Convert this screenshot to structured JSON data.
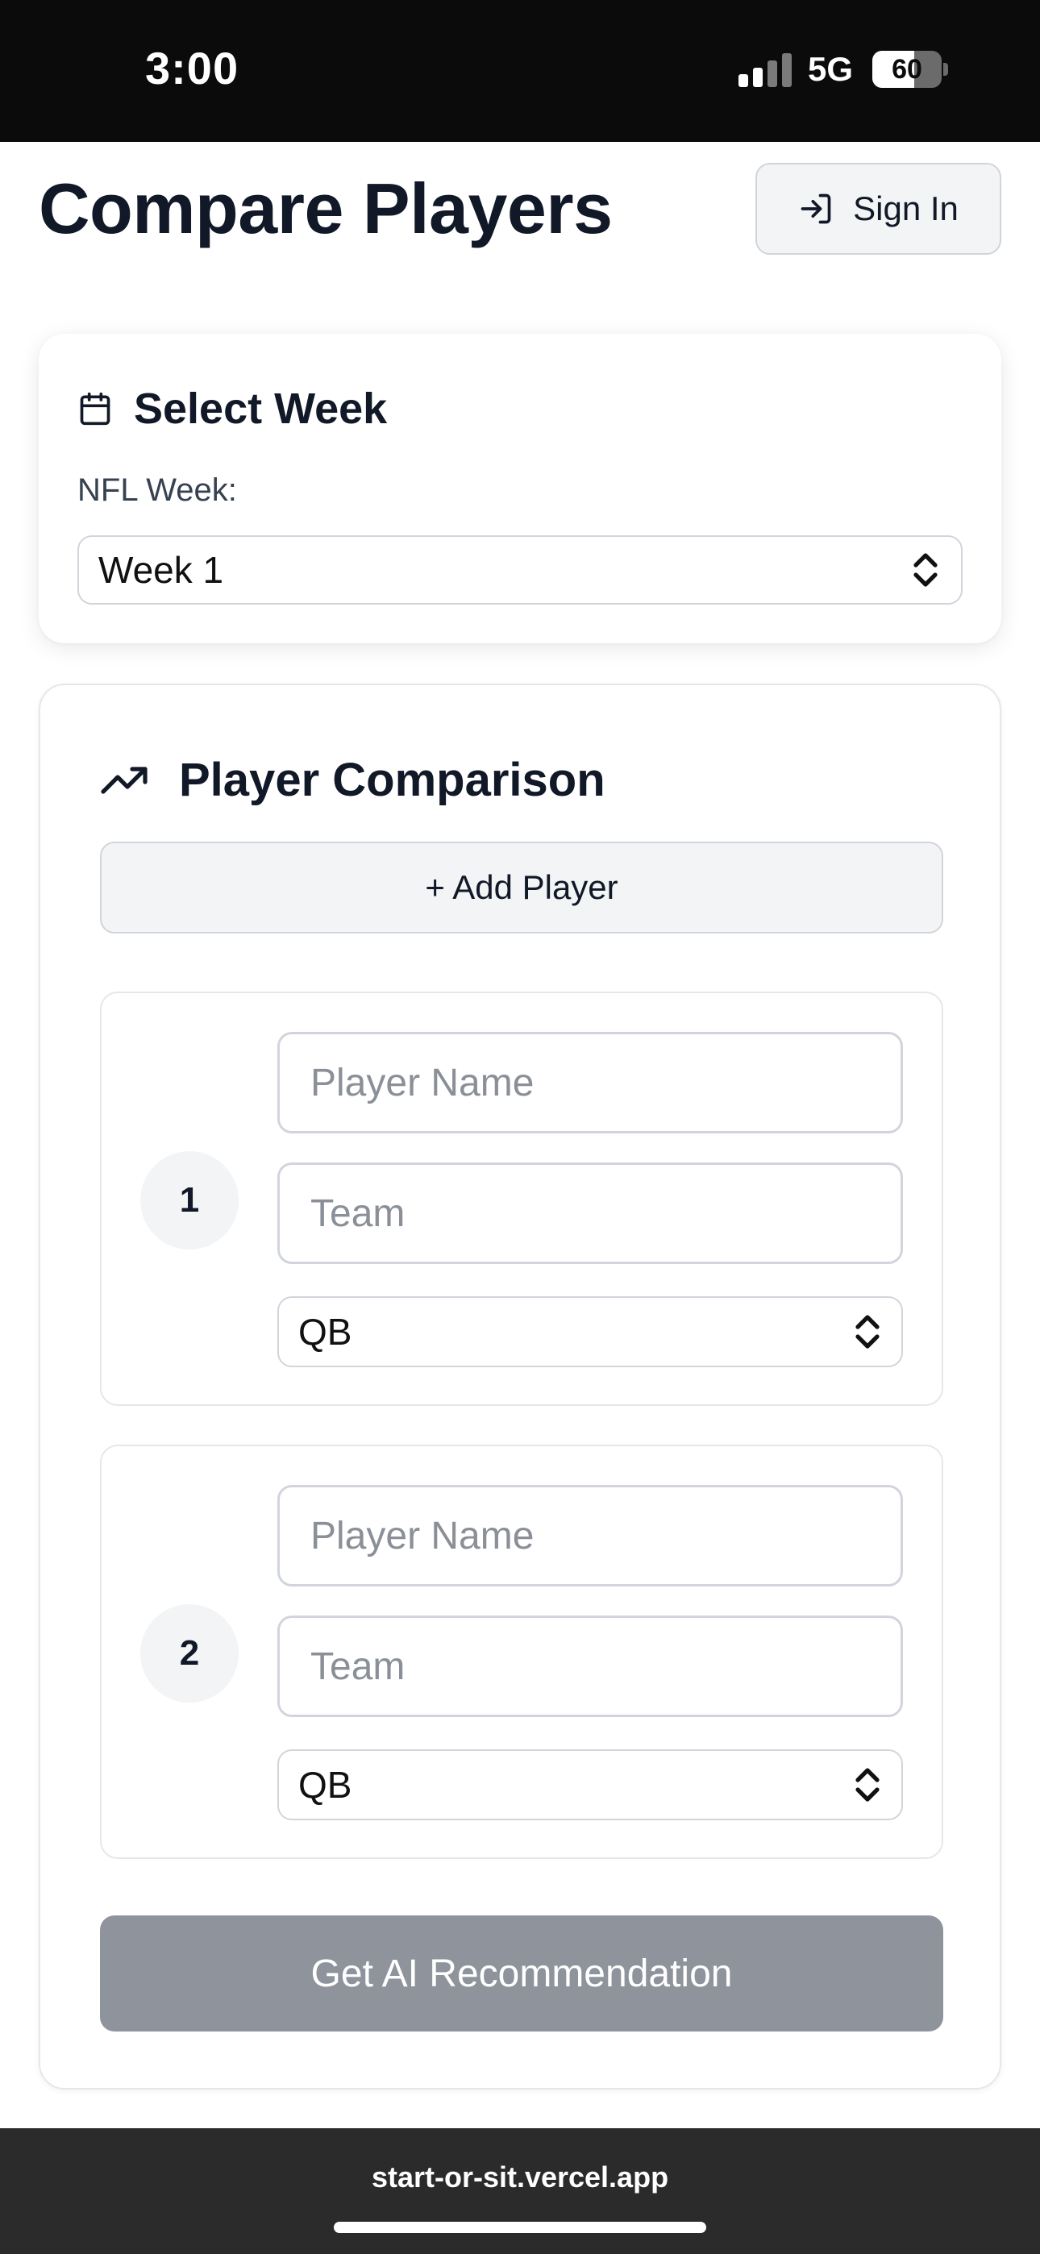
{
  "status_bar": {
    "time": "3:00",
    "network": "5G",
    "battery": "60",
    "battery_level": 0.6
  },
  "header": {
    "title": "Compare Players",
    "sign_in_label": "Sign In"
  },
  "week_card": {
    "heading": "Select Week",
    "label": "NFL Week:",
    "selected_week": "Week 1"
  },
  "comparison": {
    "heading": "Player Comparison",
    "add_player_label": "+ Add Player",
    "players": [
      {
        "number": "1",
        "name_placeholder": "Player Name",
        "team_placeholder": "Team",
        "position": "QB"
      },
      {
        "number": "2",
        "name_placeholder": "Player Name",
        "team_placeholder": "Team",
        "position": "QB"
      }
    ],
    "submit_label": "Get AI Recommendation"
  },
  "browser": {
    "url": "start-or-sit.vercel.app"
  },
  "icons": {
    "sign_in": "log-in-icon",
    "calendar": "calendar-icon",
    "trend": "trending-up-icon",
    "select_chevrons": "chevrons-up-down-icon"
  },
  "colors": {
    "primary_text": "#111827",
    "disabled_button": "#8e939c",
    "muted_bg": "#f3f4f6",
    "border": "#d1d5db"
  }
}
